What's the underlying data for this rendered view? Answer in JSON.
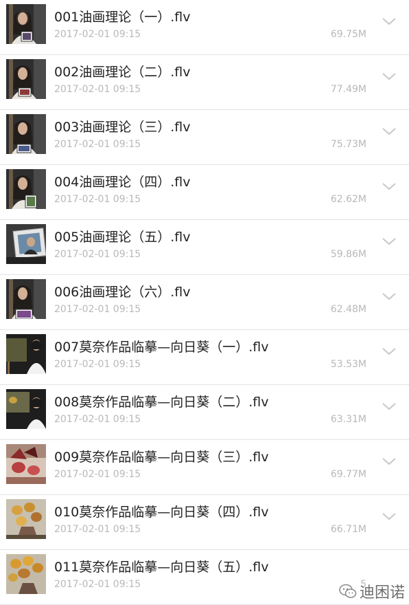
{
  "files": [
    {
      "name": "001油画理论（一）.flv",
      "date": "2017-02-01 09:15",
      "size": "69.75M"
    },
    {
      "name": "002油画理论（二）.flv",
      "date": "2017-02-01 09:15",
      "size": "77.49M"
    },
    {
      "name": "003油画理论（三）.flv",
      "date": "2017-02-01 09:15",
      "size": "75.73M"
    },
    {
      "name": "004油画理论（四）.flv",
      "date": "2017-02-01 09:15",
      "size": "62.62M"
    },
    {
      "name": "005油画理论（五）.flv",
      "date": "2017-02-01 09:15",
      "size": "59.86M"
    },
    {
      "name": "006油画理论（六）.flv",
      "date": "2017-02-01 09:15",
      "size": "62.48M"
    },
    {
      "name": "007莫奈作品临摹—向日葵（一）.flv",
      "date": "2017-02-01 09:15",
      "size": "53.53M"
    },
    {
      "name": "008莫奈作品临摹—向日葵（二）.flv",
      "date": "2017-02-01 09:15",
      "size": "63.31M"
    },
    {
      "name": "009莫奈作品临摹—向日葵（三）.flv",
      "date": "2017-02-01 09:15",
      "size": "69.77M"
    },
    {
      "name": "010莫奈作品临摹—向日葵（四）.flv",
      "date": "2017-02-01 09:15",
      "size": "66.71M"
    },
    {
      "name": "011莫奈作品临摹—向日葵（五）.flv",
      "date": "2017-02-01 09:15",
      "size": "5"
    }
  ],
  "watermark": {
    "text": "迪困诺"
  },
  "colors": {
    "title": "#222222",
    "meta": "#b8b8b8",
    "divider": "#e3e3e3",
    "chevron": "#c8c8c8"
  }
}
